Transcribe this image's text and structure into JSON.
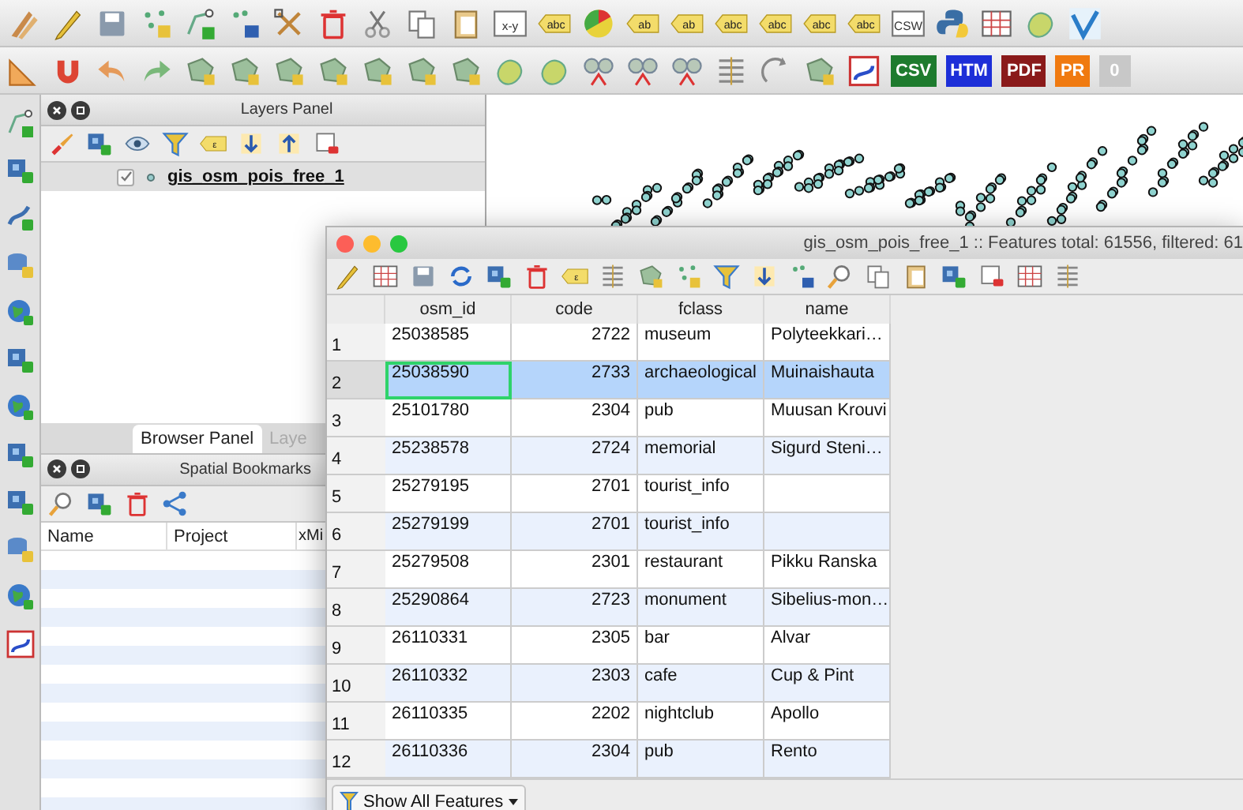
{
  "toolbars": [
    [
      {
        "kind": "pencils"
      },
      {
        "kind": "pencil"
      },
      {
        "kind": "save"
      },
      {
        "kind": "points"
      },
      {
        "kind": "line-nodes"
      },
      {
        "kind": "points-move"
      },
      {
        "kind": "node-tool"
      },
      {
        "kind": "trash"
      },
      {
        "kind": "cut"
      },
      {
        "kind": "copy"
      },
      {
        "kind": "paste"
      },
      {
        "kind": "text-box",
        "text": "x-y"
      },
      {
        "kind": "label",
        "text": "abc"
      },
      {
        "kind": "pie"
      },
      {
        "kind": "label",
        "text": "ab"
      },
      {
        "kind": "label",
        "text": "ab"
      },
      {
        "kind": "label",
        "text": "abc"
      },
      {
        "kind": "label",
        "text": "abc"
      },
      {
        "kind": "label",
        "text": "abc"
      },
      {
        "kind": "label",
        "text": "abc"
      },
      {
        "kind": "text-box",
        "text": "CSW"
      },
      {
        "kind": "python"
      },
      {
        "kind": "table"
      },
      {
        "kind": "blob"
      },
      {
        "kind": "logo"
      }
    ],
    [
      {
        "kind": "ruler"
      },
      {
        "kind": "magnet"
      },
      {
        "kind": "undo"
      },
      {
        "kind": "redo"
      },
      {
        "kind": "polygon"
      },
      {
        "kind": "polygon"
      },
      {
        "kind": "polygon"
      },
      {
        "kind": "polygon"
      },
      {
        "kind": "polygon"
      },
      {
        "kind": "polygon"
      },
      {
        "kind": "polygon"
      },
      {
        "kind": "blob"
      },
      {
        "kind": "blob"
      },
      {
        "kind": "split"
      },
      {
        "kind": "split"
      },
      {
        "kind": "split"
      },
      {
        "kind": "rows"
      },
      {
        "kind": "rotate"
      },
      {
        "kind": "polygon"
      },
      {
        "kind": "route"
      },
      {
        "kind": "badge",
        "text": "CSV",
        "color": "#1e7b2e"
      },
      {
        "kind": "badge",
        "text": "HTM",
        "color": "#1d2fd8"
      },
      {
        "kind": "badge",
        "text": "PDF",
        "color": "#8a1a1a"
      },
      {
        "kind": "badge",
        "text": "PR",
        "color": "#f07a10"
      },
      {
        "kind": "badge",
        "text": "0",
        "color": "#c8c8c8"
      }
    ]
  ],
  "side_toolbar": [
    {
      "kind": "line-nodes"
    },
    {
      "kind": "layer-add"
    },
    {
      "kind": "line-add"
    },
    {
      "kind": "db-add"
    },
    {
      "kind": "globe"
    },
    {
      "kind": "layer-add"
    },
    {
      "kind": "globe"
    },
    {
      "kind": "layer-add"
    },
    {
      "kind": "layer-add"
    },
    {
      "kind": "db-add"
    },
    {
      "kind": "globe"
    },
    {
      "kind": "route"
    }
  ],
  "layers_panel": {
    "title": "Layers Panel",
    "tools": [
      {
        "kind": "brush"
      },
      {
        "kind": "layer-add"
      },
      {
        "kind": "eye"
      },
      {
        "kind": "filter"
      },
      {
        "kind": "label",
        "text": "ε"
      },
      {
        "kind": "expand"
      },
      {
        "kind": "collapse"
      },
      {
        "kind": "remove"
      }
    ],
    "layers": [
      {
        "name": "gis_osm_pois_free_1",
        "checked": true
      }
    ]
  },
  "dock_tabs": [
    {
      "label": "Browser Panel",
      "selected": true
    },
    {
      "label": "Laye",
      "selected": false
    }
  ],
  "bookmarks_panel": {
    "title": "Spatial Bookmarks",
    "tools": [
      {
        "kind": "zoom"
      },
      {
        "kind": "layer-add"
      },
      {
        "kind": "trash"
      },
      {
        "kind": "share"
      }
    ],
    "columns": [
      "Name",
      "Project",
      "xMi"
    ]
  },
  "attribute_window": {
    "title": "gis_osm_pois_free_1 :: Features total: 61556, filtered: 61",
    "tools": [
      {
        "kind": "pencil"
      },
      {
        "kind": "table"
      },
      {
        "kind": "save"
      },
      {
        "kind": "refresh"
      },
      {
        "kind": "layer-add"
      },
      {
        "kind": "trash"
      },
      {
        "kind": "label",
        "text": "ε"
      },
      {
        "kind": "rows"
      },
      {
        "kind": "polygon"
      },
      {
        "kind": "points"
      },
      {
        "kind": "filter"
      },
      {
        "kind": "expand"
      },
      {
        "kind": "points-move"
      },
      {
        "kind": "zoom"
      },
      {
        "kind": "copy"
      },
      {
        "kind": "paste"
      },
      {
        "kind": "layer-add"
      },
      {
        "kind": "remove"
      },
      {
        "kind": "table"
      },
      {
        "kind": "rows"
      }
    ],
    "columns": [
      "osm_id",
      "code",
      "fclass",
      "name"
    ],
    "rows": [
      {
        "number": "1",
        "osm_id": "25038585",
        "code": "2722",
        "fclass": "museum",
        "name": "Polyteekkari…",
        "selected": false,
        "current": false
      },
      {
        "number": "2",
        "osm_id": "25038590",
        "code": "2733",
        "fclass": "archaeological",
        "name": "Muinaishauta",
        "selected": true,
        "current": true
      },
      {
        "number": "3",
        "osm_id": "25101780",
        "code": "2304",
        "fclass": "pub",
        "name": "Muusan Krouvi",
        "selected": false,
        "current": false
      },
      {
        "number": "4",
        "osm_id": "25238578",
        "code": "2724",
        "fclass": "memorial",
        "name": "Sigurd Steni…",
        "selected": false,
        "current": false
      },
      {
        "number": "5",
        "osm_id": "25279195",
        "code": "2701",
        "fclass": "tourist_info",
        "selected": false,
        "current": false
      },
      {
        "number": "6",
        "osm_id": "25279199",
        "code": "2701",
        "fclass": "tourist_info",
        "selected": false,
        "current": false
      },
      {
        "number": "7",
        "osm_id": "25279508",
        "code": "2301",
        "fclass": "restaurant",
        "name": "Pikku Ranska",
        "selected": false,
        "current": false
      },
      {
        "number": "8",
        "osm_id": "25290864",
        "code": "2723",
        "fclass": "monument",
        "name": "Sibelius-mon…",
        "selected": false,
        "current": false
      },
      {
        "number": "9",
        "osm_id": "26110331",
        "code": "2305",
        "fclass": "bar",
        "name": "Alvar",
        "selected": false,
        "current": false
      },
      {
        "number": "10",
        "osm_id": "26110332",
        "code": "2303",
        "fclass": "cafe",
        "name": "Cup & Pint",
        "selected": false,
        "current": false
      },
      {
        "number": "11",
        "osm_id": "26110335",
        "code": "2202",
        "fclass": "nightclub",
        "name": "Apollo",
        "selected": false,
        "current": false
      },
      {
        "number": "12",
        "osm_id": "26110336",
        "code": "2304",
        "fclass": "pub",
        "name": "Rento",
        "selected": false,
        "current": false
      }
    ],
    "filter_button": "Show All Features"
  }
}
